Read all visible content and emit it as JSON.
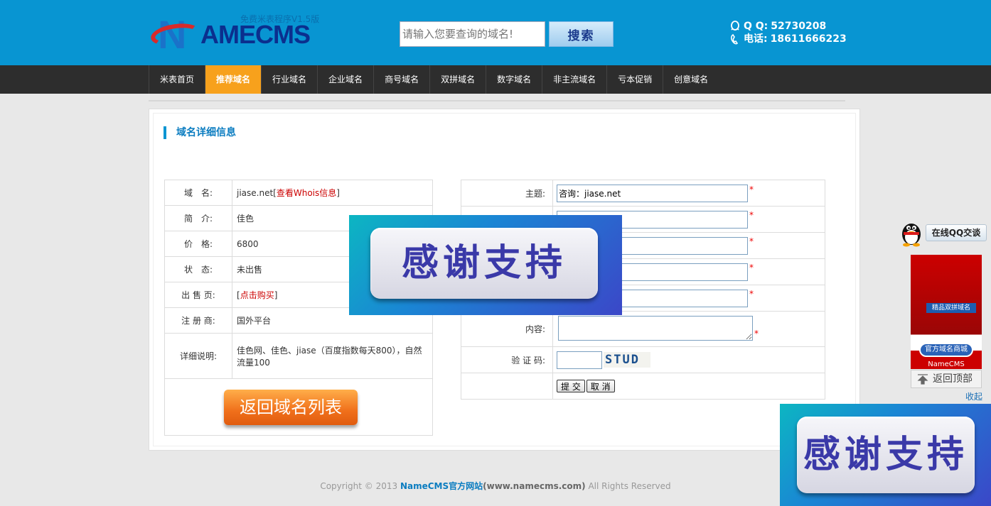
{
  "header": {
    "logo_subtitle": "免费米表程序V1.5版",
    "logo_letter": "N",
    "logo_text": "AMECMS",
    "search_placeholder": "请输入您要查询的域名!",
    "search_button": "搜索",
    "qq_label": "Q Q:",
    "qq_value": "52730208",
    "phone_label": "电话:",
    "phone_value": "18611666223"
  },
  "nav": {
    "items": [
      {
        "label": "米表首页"
      },
      {
        "label": "推荐域名",
        "active": true
      },
      {
        "label": "行业域名"
      },
      {
        "label": "企业域名"
      },
      {
        "label": "商号域名"
      },
      {
        "label": "双拼域名"
      },
      {
        "label": "数字域名"
      },
      {
        "label": "非主流域名"
      },
      {
        "label": "亏本促销"
      },
      {
        "label": "创意域名"
      }
    ]
  },
  "detail": {
    "title": "域名详细信息",
    "rows": {
      "domain_label": "域　名:",
      "domain_value": "jiase.net",
      "whois_link": "查看Whois信息",
      "intro_label": "简　介:",
      "intro_value": "佳色",
      "price_label": "价　格:",
      "price_value": "6800",
      "status_label": "状　态:",
      "status_value": "未出售",
      "sale_label": "出 售 页:",
      "buy_link": "点击购买",
      "registrar_label": "注 册 商:",
      "registrar_value": "国外平台",
      "desc_label": "详细说明:",
      "desc_value": "佳色网、佳色、jiase（百度指数每天800），自然流量100"
    },
    "back_button": "返回域名列表"
  },
  "form": {
    "subject_label": "主题:",
    "subject_value": "咨询：jiase.net",
    "content_label": "内容:",
    "captcha_label": "验 证 码:",
    "captcha_text": "STUD",
    "required_mark": "*",
    "submit_button": "提 交",
    "cancel_button": "取 消"
  },
  "overlay": {
    "thanks_text": "感谢支持"
  },
  "float": {
    "qq_chat": "在线QQ交谈",
    "ad_sign": "精品双拼域名",
    "ad_mall": "官方域名商城",
    "ad_brand": "NameCMS",
    "back_to_top": "返回顶部",
    "collapse": "收起"
  },
  "footer": {
    "prefix": "Copyright © 2013 ",
    "brand": "NameCMS官方网站",
    "site": "(www.namecms.com)",
    "suffix": " All Rights Reserved"
  },
  "colors": {
    "header_bg": "#0895d2",
    "nav_bg": "#2d2d2d",
    "nav_active": "#f7a11c",
    "accent_blue": "#0a7cc0",
    "link_red": "#cc0000"
  }
}
